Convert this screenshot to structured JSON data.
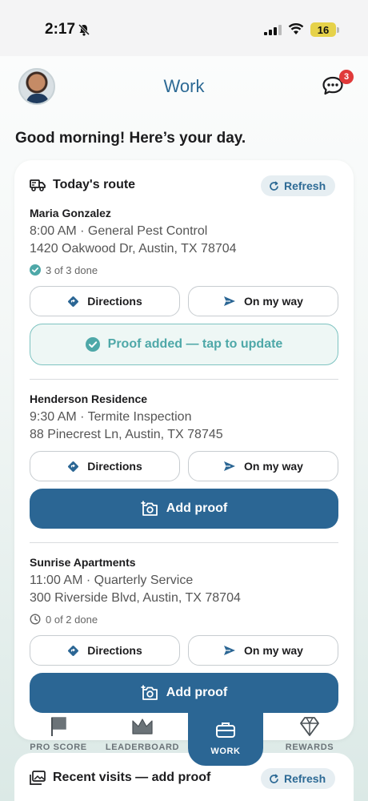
{
  "status": {
    "time": "2:17",
    "battery": "16"
  },
  "header": {
    "title": "Work",
    "chat_badge": "3"
  },
  "greeting": "Good morning! Here’s your day.",
  "route_card": {
    "title": "Today's route",
    "refresh_label": "Refresh",
    "jobs": [
      {
        "name": "Maria Gonzalez",
        "time_service": "8:00 AM · General Pest Control",
        "address": "1420 Oakwood Dr, Austin, TX 78704",
        "progress": "3 of 3 done",
        "directions_label": "Directions",
        "on_my_way_label": "On my way",
        "proof_label": "Proof added — tap to update"
      },
      {
        "name": "Henderson Residence",
        "time_service": "9:30 AM · Termite Inspection",
        "address": "88 Pinecrest Ln, Austin, TX 78745",
        "directions_label": "Directions",
        "on_my_way_label": "On my way",
        "proof_label": "Add proof"
      },
      {
        "name": "Sunrise Apartments",
        "time_service": "11:00 AM · Quarterly Service",
        "address": "300 Riverside Blvd, Austin, TX 78704",
        "progress": "0 of 2 done",
        "directions_label": "Directions",
        "on_my_way_label": "On my way",
        "proof_label": "Add proof"
      }
    ]
  },
  "tabbar": {
    "pro_score": "PRO SCORE",
    "leaderboard": "LEADERBOARD",
    "work": "WORK",
    "rewards": "REWARDS"
  },
  "recent_card": {
    "title": "Recent visits — add proof",
    "refresh_label": "Refresh"
  },
  "colors": {
    "primary": "#2b6694",
    "accent_teal": "#4ea8a8",
    "badge_red": "#e03a3a"
  },
  "icons": [
    "bell-off-icon",
    "signal-icon",
    "wifi-icon",
    "chat-icon",
    "truck-icon",
    "refresh-icon",
    "check-circle-icon",
    "clock-icon",
    "directions-icon",
    "send-icon",
    "camera-plus-icon",
    "flag-icon",
    "crown-icon",
    "briefcase-icon",
    "diamond-icon",
    "gallery-icon"
  ]
}
